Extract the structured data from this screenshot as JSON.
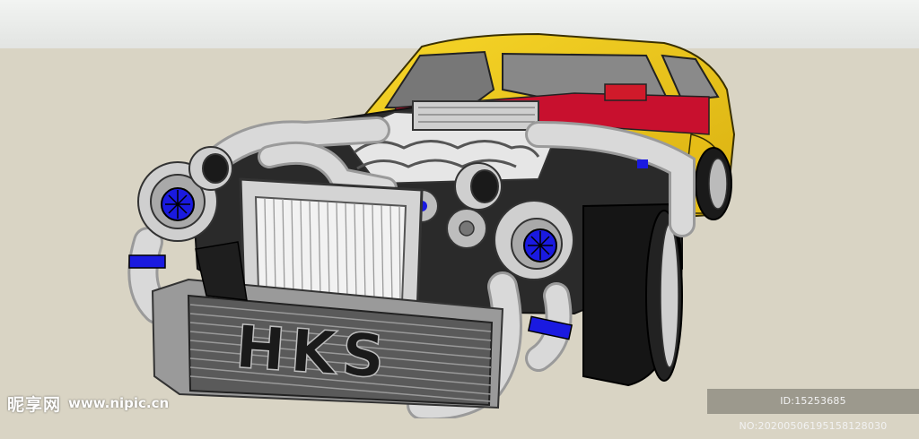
{
  "image": {
    "subject": "3D model of yellow muscle car with exposed twin-turbo V8 engine",
    "colors": {
      "sky": "#e8eae8",
      "ground": "#d9d4c4",
      "body": "#f0cc1e",
      "pipes": "#cfcfcf",
      "accent_blue": "#1a1ae0",
      "tire": "#1a1a1a"
    },
    "intercooler_text": "HKS"
  },
  "watermark": {
    "logo": "昵享网",
    "url": "www.nipic.cn",
    "id": "ID:15253685 NO:20200506195158128030"
  }
}
